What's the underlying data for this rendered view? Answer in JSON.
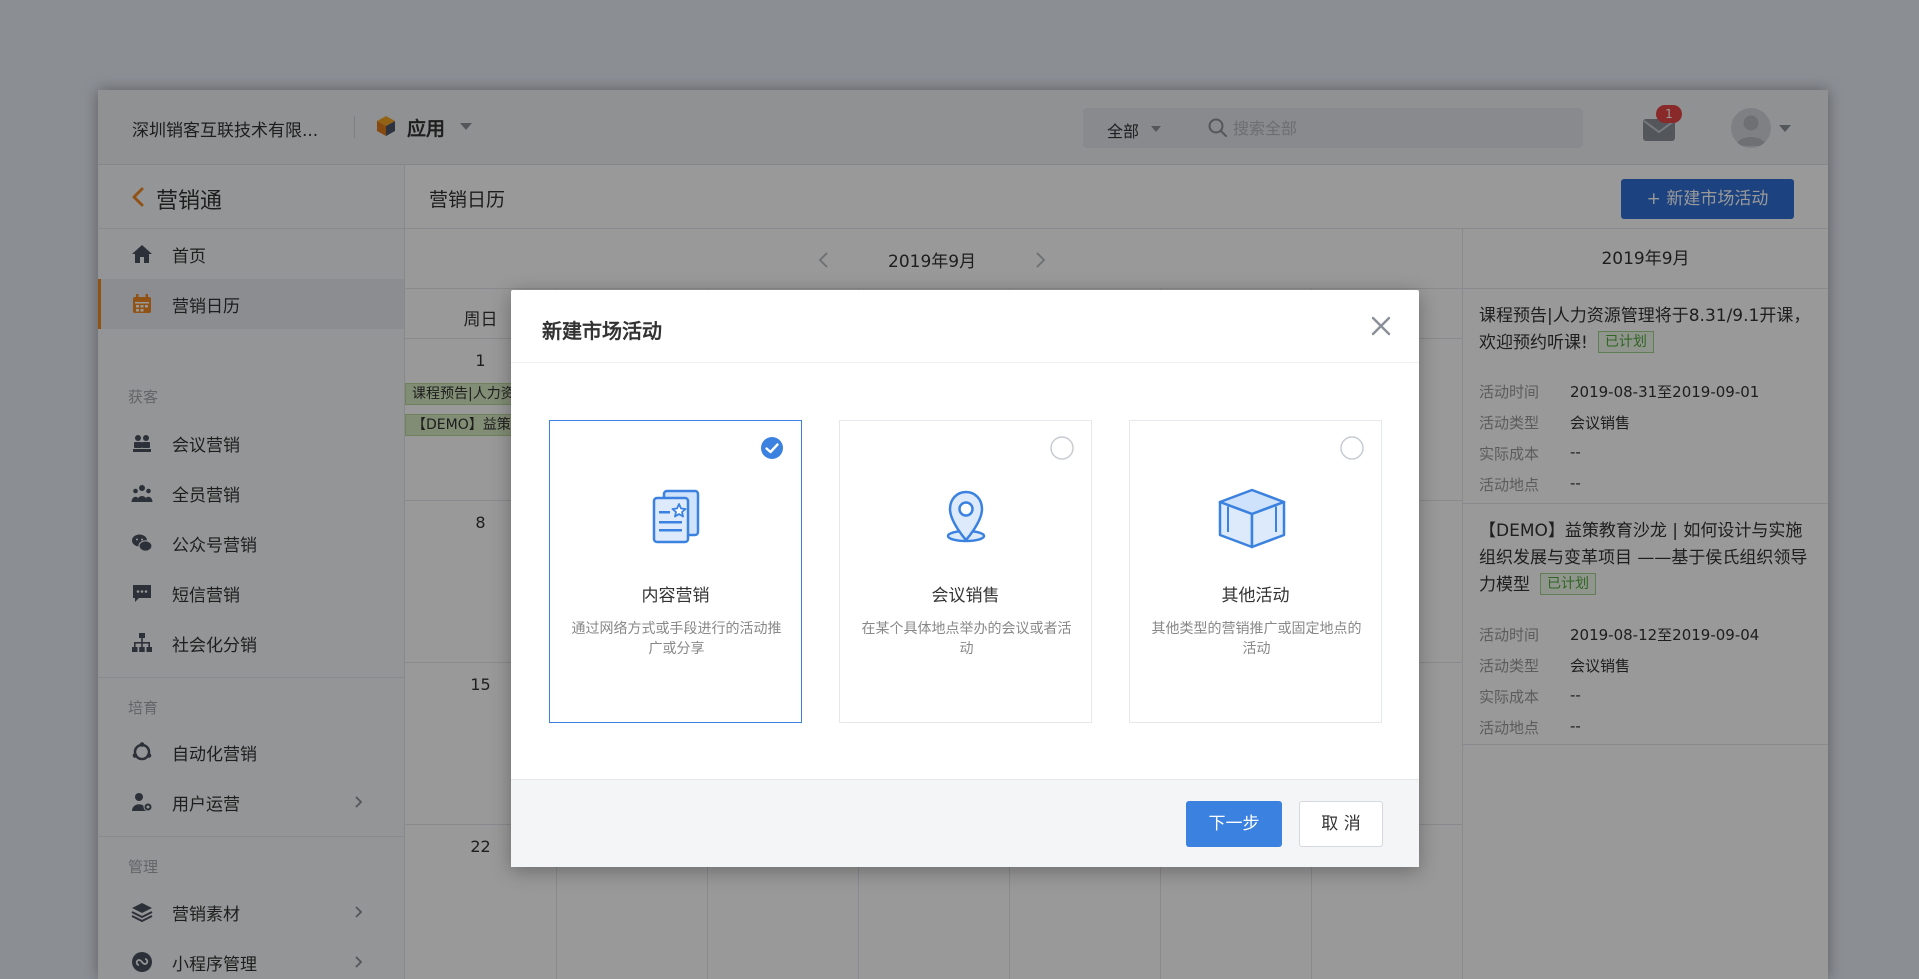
{
  "header": {
    "company": "深圳销客互联技术有限...",
    "app_name": "应用",
    "search_scope": "全部",
    "search_placeholder": "搜索全部",
    "mail_badge": "1"
  },
  "sidebar": {
    "back_title": "营销通",
    "items_top": [
      {
        "label": "首页",
        "icon": "home-icon"
      },
      {
        "label": "营销日历",
        "icon": "calendar-icon",
        "active": true
      }
    ],
    "group_acquire": "获客",
    "items_acquire": [
      {
        "label": "会议营销",
        "icon": "meeting-icon"
      },
      {
        "label": "全员营销",
        "icon": "team-icon"
      },
      {
        "label": "公众号营销",
        "icon": "wechat-icon"
      },
      {
        "label": "短信营销",
        "icon": "sms-icon"
      },
      {
        "label": "社会化分销",
        "icon": "distribution-icon"
      }
    ],
    "group_nurture": "培育",
    "items_nurture": [
      {
        "label": "自动化营销",
        "icon": "automation-icon"
      },
      {
        "label": "用户运营",
        "icon": "user-ops-icon"
      }
    ],
    "group_manage": "管理",
    "items_manage": [
      {
        "label": "营销素材",
        "icon": "layers-icon"
      },
      {
        "label": "小程序管理",
        "icon": "miniprogram-icon"
      }
    ]
  },
  "main": {
    "page_title": "营销日历",
    "new_button": "新建市场活动",
    "calendar_month": "2019年9月",
    "weekday_first": "周日",
    "day_numbers": [
      "1",
      "8",
      "15",
      "22"
    ],
    "event_chips": [
      "课程预告|人力资",
      "【DEMO】益策"
    ]
  },
  "side_panel": {
    "month": "2019年9月",
    "events": [
      {
        "title": "课程预告|人力资源管理将于8.31/9.1开课，欢迎预约听课!",
        "status": "已计划",
        "fields": [
          {
            "k": "活动时间",
            "v": "2019-08-31至2019-09-01"
          },
          {
            "k": "活动类型",
            "v": "会议销售"
          },
          {
            "k": "实际成本",
            "v": "--"
          },
          {
            "k": "活动地点",
            "v": "--"
          }
        ]
      },
      {
        "title": "【DEMO】益策教育沙龙 | 如何设计与实施组织发展与变革项目 ——基于侯氏组织领导力模型",
        "status": "已计划",
        "fields": [
          {
            "k": "活动时间",
            "v": "2019-08-12至2019-09-04"
          },
          {
            "k": "活动类型",
            "v": "会议销售"
          },
          {
            "k": "实际成本",
            "v": "--"
          },
          {
            "k": "活动地点",
            "v": "--"
          }
        ]
      }
    ]
  },
  "modal": {
    "title": "新建市场活动",
    "options": [
      {
        "title": "内容营销",
        "desc": "通过网络方式或手段进行的活动推广或分享",
        "icon": "content-doc-icon",
        "selected": true
      },
      {
        "title": "会议销售",
        "desc": "在某个具体地点举办的会议或者活动",
        "icon": "location-pin-icon",
        "selected": false
      },
      {
        "title": "其他活动",
        "desc": "其他类型的营销推广或固定地点的活动",
        "icon": "box-icon",
        "selected": false
      }
    ],
    "next_button": "下一步",
    "cancel_button": "取 消"
  },
  "colors": {
    "primary": "#3b82e0",
    "header_button": "#2f6fd6",
    "accent_orange": "#f28a24",
    "tag_green": "#53a93f",
    "badge_red": "#e64545"
  }
}
